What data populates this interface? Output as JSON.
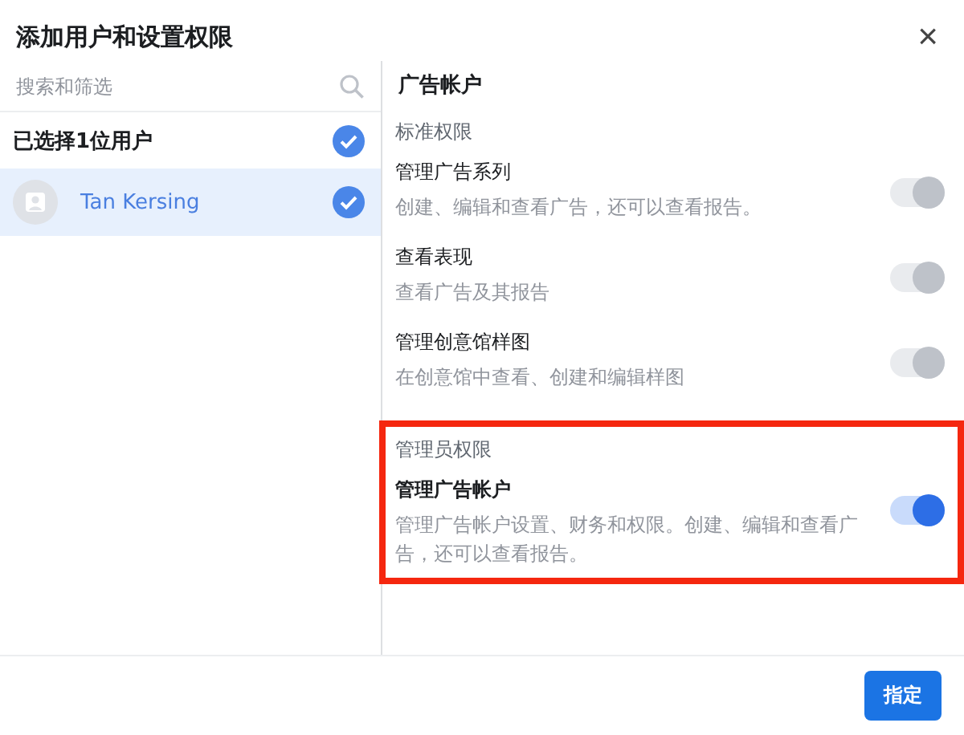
{
  "dialog": {
    "title": "添加用户和设置权限",
    "close": "×"
  },
  "sidebar": {
    "search": {
      "placeholder": "搜索和筛选"
    },
    "selected_header": {
      "label": "已选择1位用户",
      "checked": true
    },
    "users": [
      {
        "name": "Tan Kersing",
        "selected": true,
        "checked": true
      }
    ]
  },
  "panel": {
    "heading": "广告帐户",
    "sections": [
      {
        "title": "标准权限",
        "highlighted": false,
        "permissions": [
          {
            "name": "管理广告系列",
            "description": "创建、编辑和查看广告，还可以查看报告。",
            "on": true,
            "disabled": true
          },
          {
            "name": "查看表现",
            "description": "查看广告及其报告",
            "on": true,
            "disabled": true
          },
          {
            "name": "管理创意馆样图",
            "description": "在创意馆中查看、创建和编辑样图",
            "on": true,
            "disabled": true
          }
        ]
      },
      {
        "title": "管理员权限",
        "highlighted": true,
        "permissions": [
          {
            "name": "管理广告帐户",
            "description": "管理广告帐户设置、财务和权限。创建、编辑和查看广告，还可以查看报告。",
            "on": true,
            "disabled": false
          }
        ]
      }
    ]
  },
  "footer": {
    "button": "指定"
  }
}
